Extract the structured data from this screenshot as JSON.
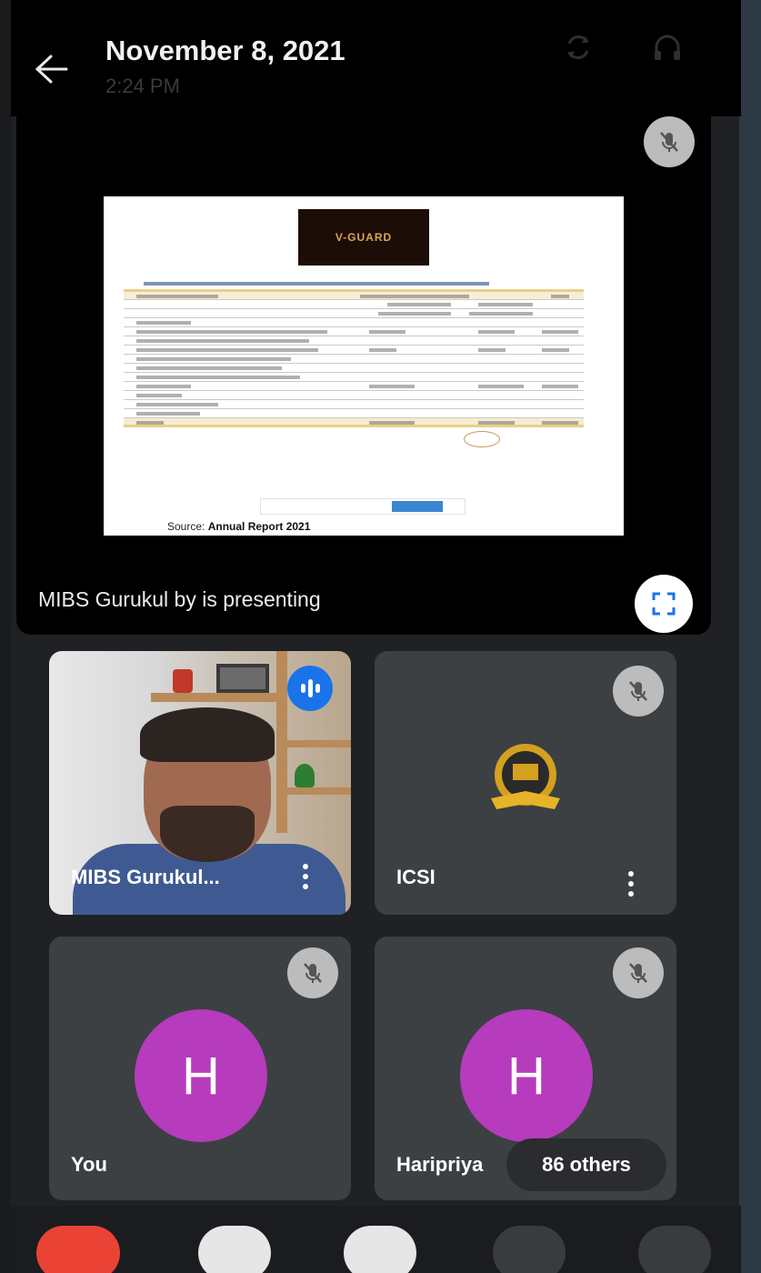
{
  "header": {
    "title": "November 8, 2021",
    "time": "2:24 PM"
  },
  "presentation": {
    "presenter_label": "MIBS Gurukul by is presenting",
    "slide": {
      "logo_text": "V-GUARD",
      "source_label": "Source:",
      "source_value": "Annual Report 2021"
    }
  },
  "participants": [
    {
      "name": "MIBS Gurukul...",
      "type": "video",
      "speaking": true
    },
    {
      "name": "ICSI",
      "type": "logo",
      "muted": true
    },
    {
      "name": "You",
      "avatar_letter": "H",
      "muted": true
    },
    {
      "name": "Haripriya",
      "avatar_letter": "H",
      "muted": true
    }
  ],
  "others_pill": "86 others",
  "colors": {
    "avatar": "#b63bbd",
    "speaking": "#1a73e8",
    "end_call": "#ea4335",
    "tile": "#3c4043"
  },
  "icons": {
    "back": "arrow-left-icon",
    "switch_camera": "camera-switch-icon",
    "audio": "headphones-icon",
    "mute": "mic-off-icon",
    "fullscreen": "fullscreen-icon",
    "more": "more-vert-icon"
  }
}
